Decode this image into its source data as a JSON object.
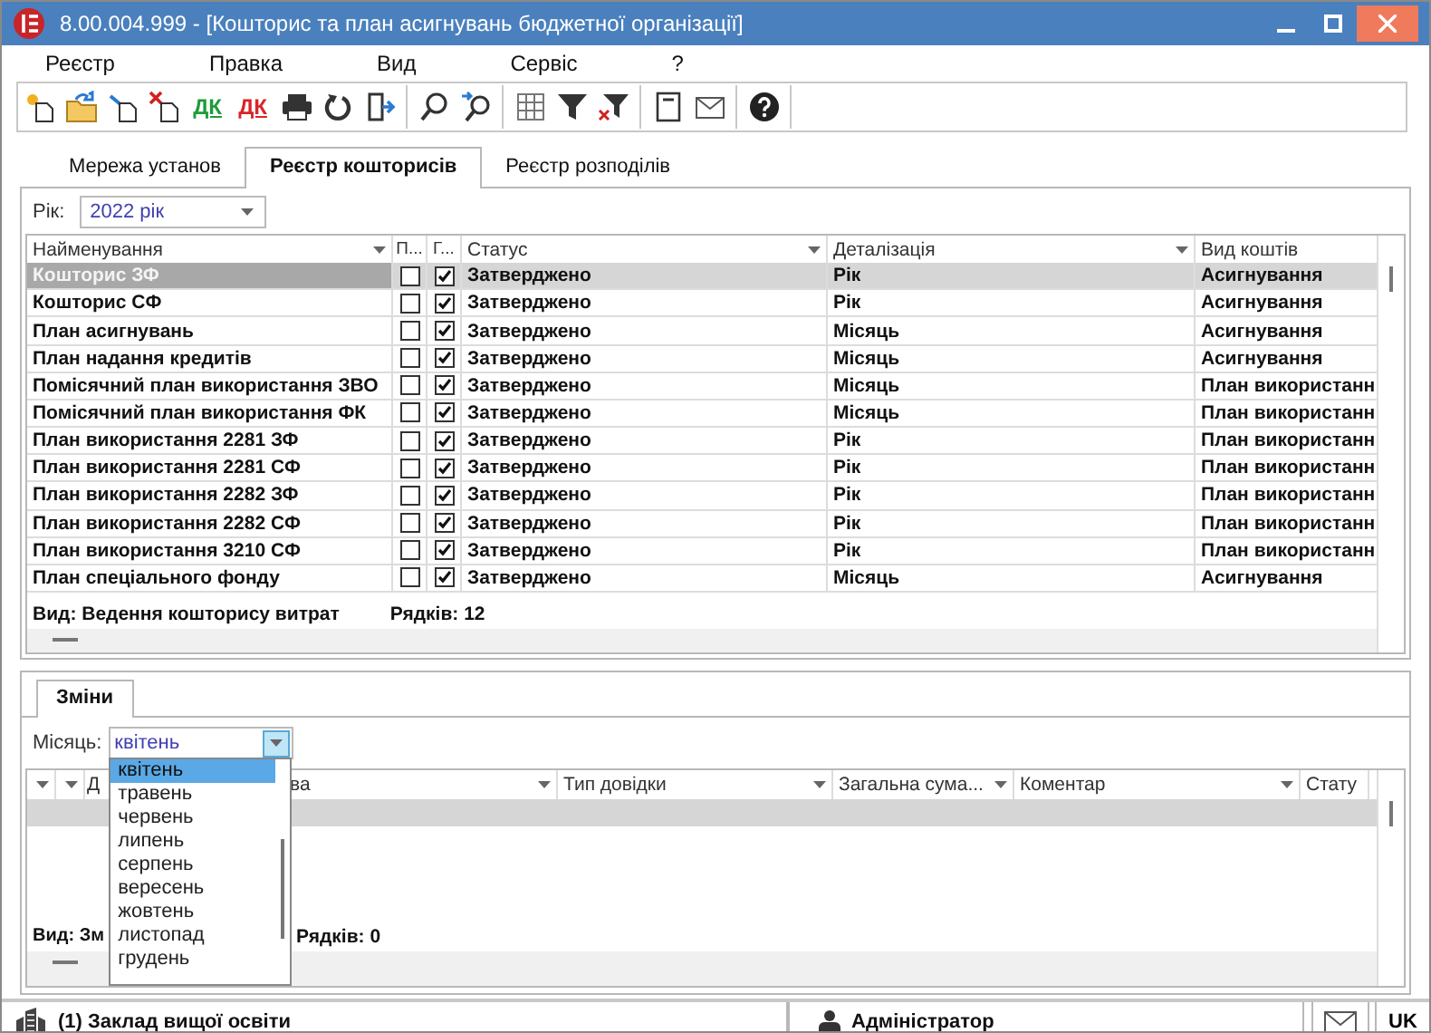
{
  "window": {
    "title": "8.00.004.999 - [Кошторис та план асигнувань бюджетної організації]"
  },
  "menu": [
    "Реєстр",
    "Правка",
    "Вид",
    "Сервіс",
    "?"
  ],
  "toolbar": [
    {
      "kind": "new"
    },
    {
      "kind": "open"
    },
    {
      "kind": "copy"
    },
    {
      "kind": "delete"
    },
    {
      "kind": "debit",
      "label": "ДК"
    },
    {
      "kind": "credit",
      "label": "ДК"
    },
    {
      "kind": "print"
    },
    {
      "kind": "refresh"
    },
    {
      "kind": "exit"
    },
    {
      "kind": "separator"
    },
    {
      "kind": "find"
    },
    {
      "kind": "find-next"
    },
    {
      "kind": "separator"
    },
    {
      "kind": "grid"
    },
    {
      "kind": "filter"
    },
    {
      "kind": "filter-clear"
    },
    {
      "kind": "separator"
    },
    {
      "kind": "document"
    },
    {
      "kind": "mail"
    },
    {
      "kind": "separator"
    },
    {
      "kind": "help"
    },
    {
      "kind": "separator"
    }
  ],
  "tabs": [
    {
      "label": "Мережа установ",
      "selected": false
    },
    {
      "label": "Реєстр кошторисів",
      "selected": true
    },
    {
      "label": "Реєстр розподілів",
      "selected": false
    }
  ],
  "year": {
    "label": "Рік:",
    "value": "2022 рік"
  },
  "registry": {
    "columns": [
      {
        "label": "Найменування",
        "filter": true
      },
      {
        "label": "П...",
        "filter": false
      },
      {
        "label": "Г...",
        "filter": false
      },
      {
        "label": "Статус",
        "filter": true
      },
      {
        "label": "Деталізація",
        "filter": true
      },
      {
        "label": "Вид коштів",
        "filter": false
      }
    ],
    "rows": [
      {
        "name": "Кошторис ЗФ",
        "p": false,
        "g": true,
        "status": "Затверджено",
        "detail": "Рік",
        "funds": "Асигнування",
        "selected": true
      },
      {
        "name": "Кошторис СФ",
        "p": false,
        "g": true,
        "status": "Затверджено",
        "detail": "Рік",
        "funds": "Асигнування",
        "selected": false
      },
      {
        "name": "План асигнувань",
        "p": false,
        "g": true,
        "status": "Затверджено",
        "detail": "Місяць",
        "funds": "Асигнування",
        "selected": false
      },
      {
        "name": "План надання кредитів",
        "p": false,
        "g": true,
        "status": "Затверджено",
        "detail": "Місяць",
        "funds": "Асигнування",
        "selected": false
      },
      {
        "name": "Помісячний план використання ЗВО",
        "p": false,
        "g": true,
        "status": "Затверджено",
        "detail": "Місяць",
        "funds": "План використанн",
        "selected": false
      },
      {
        "name": "Помісячний план використання ФК",
        "p": false,
        "g": true,
        "status": "Затверджено",
        "detail": "Місяць",
        "funds": "План використанн",
        "selected": false
      },
      {
        "name": "План використання 2281 ЗФ",
        "p": false,
        "g": true,
        "status": "Затверджено",
        "detail": "Рік",
        "funds": "План використанн",
        "selected": false
      },
      {
        "name": "План використання 2281 СФ",
        "p": false,
        "g": true,
        "status": "Затверджено",
        "detail": "Рік",
        "funds": "План використанн",
        "selected": false
      },
      {
        "name": "План використання 2282 ЗФ",
        "p": false,
        "g": true,
        "status": "Затверджено",
        "detail": "Рік",
        "funds": "План використанн",
        "selected": false
      },
      {
        "name": "План використання 2282 СФ",
        "p": false,
        "g": true,
        "status": "Затверджено",
        "detail": "Рік",
        "funds": "План використанн",
        "selected": false
      },
      {
        "name": "План використання 3210 СФ",
        "p": false,
        "g": true,
        "status": "Затверджено",
        "detail": "Рік",
        "funds": "План використанн",
        "selected": false
      },
      {
        "name": "План спеціального фонду",
        "p": false,
        "g": true,
        "status": "Затверджено",
        "detail": "Місяць",
        "funds": "Асигнування",
        "selected": false
      }
    ],
    "footer": {
      "view": "Вид: Ведення кошторису витрат",
      "count": "Рядків: 12"
    }
  },
  "changes": {
    "tab": {
      "label": "Зміни",
      "selected": true
    },
    "month": {
      "label": "Місяць:",
      "value": "квітень",
      "options": [
        {
          "label": "квітень",
          "selected": true
        },
        {
          "label": "травень",
          "selected": false
        },
        {
          "label": "червень",
          "selected": false
        },
        {
          "label": "липень",
          "selected": false
        },
        {
          "label": "серпень",
          "selected": false
        },
        {
          "label": "вересень",
          "selected": false
        },
        {
          "label": "жовтень",
          "selected": false
        },
        {
          "label": "листопад",
          "selected": false
        },
        {
          "label": "грудень",
          "selected": false
        }
      ]
    },
    "columns": [
      {
        "filter": true
      },
      {
        "filter": true
      },
      {
        "label": "Д",
        "filter": false
      },
      {
        "label": "ва",
        "filter": true
      },
      {
        "label": "Тип довідки",
        "filter": true
      },
      {
        "label": "Загальна сума...",
        "filter": true
      },
      {
        "label": "Коментар",
        "filter": true
      },
      {
        "label": "Стату",
        "filter": false
      }
    ],
    "footer": {
      "view": "Вид: Зм",
      "count": "Рядків: 0"
    }
  },
  "status_bar": {
    "organization": "(1) Заклад вищої освіти",
    "user": "Адміністратор",
    "language": "UK"
  }
}
